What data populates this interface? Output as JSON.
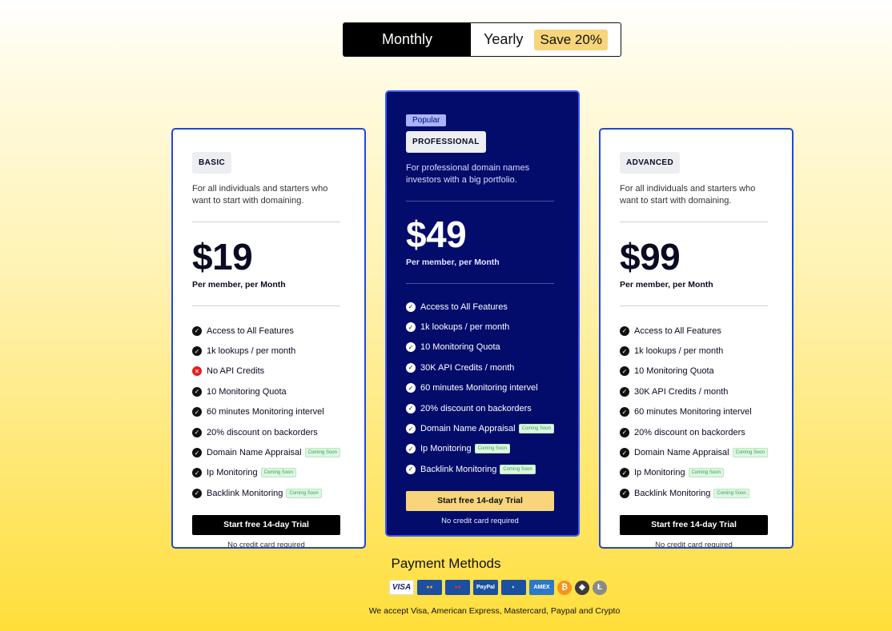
{
  "toggle": {
    "monthly": "Monthly",
    "yearly": "Yearly",
    "save": "Save 20%"
  },
  "plans": {
    "basic": {
      "tag": "BASIC",
      "desc": "For all individuals and starters who want to start with domaining.",
      "price": "$19",
      "per": "Per member, per Month",
      "features": [
        {
          "label": "Access to All Features",
          "status": "check"
        },
        {
          "label": "1k lookups / per month",
          "status": "check"
        },
        {
          "label": "No API Credits",
          "status": "cross"
        },
        {
          "label": "10 Monitoring Quota",
          "status": "check"
        },
        {
          "label": "60 minutes Monitoring intervel",
          "status": "check"
        },
        {
          "label": "20% discount on backorders",
          "status": "check"
        },
        {
          "label": "Domain Name Appraisal",
          "status": "check",
          "badge": "Coming Soon"
        },
        {
          "label": "Ip Monitoring",
          "status": "check",
          "badge": "Coming Soon"
        },
        {
          "label": "Backlink Monitoring",
          "status": "check",
          "badge": "Coming Soon"
        }
      ],
      "cta": "Start free 14-day Trial",
      "note": "No credit card required"
    },
    "pro": {
      "popular": "Popular",
      "tag": "PROFESSIONAL",
      "desc": "For professional domain names investors with a big portfolio.",
      "price": "$49",
      "per": "Per member, per Month",
      "features": [
        {
          "label": "Access to All Features",
          "status": "check"
        },
        {
          "label": "1k lookups / per month",
          "status": "check"
        },
        {
          "label": "10 Monitoring Quota",
          "status": "check"
        },
        {
          "label": "30K API Credits / month",
          "status": "check"
        },
        {
          "label": "60 minutes Monitoring intervel",
          "status": "check"
        },
        {
          "label": "20% discount on backorders",
          "status": "check"
        },
        {
          "label": "Domain Name Appraisal",
          "status": "check",
          "badge": "Coming Soon"
        },
        {
          "label": "Ip Monitoring",
          "status": "check",
          "badge": "Coming Soon"
        },
        {
          "label": "Backlink Monitoring",
          "status": "check",
          "badge": "Coming Soon"
        }
      ],
      "cta": "Start free 14-day Trial",
      "note": "No credit card required"
    },
    "advanced": {
      "tag": "ADVANCED",
      "desc": "For all individuals and starters who want to start with domaining.",
      "price": "$99",
      "per": "Per member, per Month",
      "features": [
        {
          "label": "Access to All Features",
          "status": "check"
        },
        {
          "label": "1k lookups / per month",
          "status": "check"
        },
        {
          "label": "10 Monitoring Quota",
          "status": "check"
        },
        {
          "label": "30K API Credits / month",
          "status": "check"
        },
        {
          "label": "60 minutes Monitoring intervel",
          "status": "check"
        },
        {
          "label": "20% discount on backorders",
          "status": "check"
        },
        {
          "label": "Domain Name Appraisal",
          "status": "check",
          "badge": "Coming Soon"
        },
        {
          "label": "Ip Monitoring",
          "status": "check",
          "badge": "Coming Soon"
        },
        {
          "label": "Backlink Monitoring",
          "status": "check",
          "badge": "Coming Soon"
        }
      ],
      "cta": "Start free 14-day Trial",
      "note": "No credit card required"
    }
  },
  "payment": {
    "title": "Payment Methods",
    "icons": [
      {
        "name": "visa-icon",
        "label": "VISA",
        "bg": "#ffffff",
        "fg": "#1a1f71"
      },
      {
        "name": "mastercard-icon",
        "label": "●●",
        "bg": "#1b4fa0",
        "fg": "#f79e1b"
      },
      {
        "name": "maestro-icon",
        "label": "●●",
        "bg": "#1b4fa0",
        "fg": "#e3342f"
      },
      {
        "name": "paypal-icon",
        "label": "PayPal",
        "bg": "#1b4fa0",
        "fg": "#ffffff"
      },
      {
        "name": "diners-icon",
        "label": "◐",
        "bg": "#1b4fa0",
        "fg": "#ffffff"
      },
      {
        "name": "amex-icon",
        "label": "AMEX",
        "bg": "#2c79c7",
        "fg": "#ffffff"
      }
    ],
    "coins": [
      {
        "name": "bitcoin-icon",
        "label": "₿",
        "bg": "#f7931a"
      },
      {
        "name": "ethereum-icon",
        "label": "◆",
        "bg": "#3c3c3d"
      },
      {
        "name": "litecoin-icon",
        "label": "Ł",
        "bg": "#8a8a8a"
      }
    ],
    "note": "We accept Visa, American Express, Mastercard, Paypal and Crypto"
  }
}
